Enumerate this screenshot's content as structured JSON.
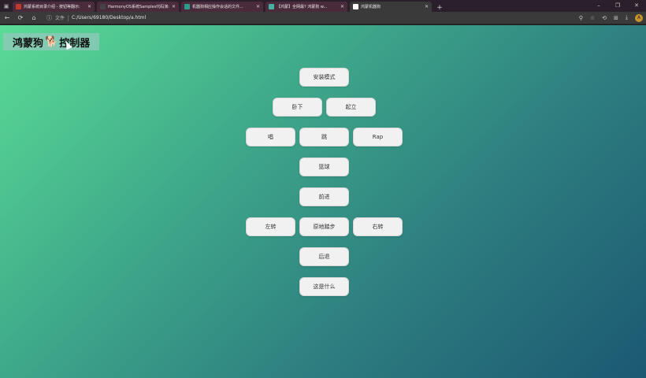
{
  "browser": {
    "tabs": [
      {
        "title": "鸿蒙系统目录介绍 - 按钮等翻示:",
        "color": "#c0392b"
      },
      {
        "title": "HarmonyOS系统Samples代码演:",
        "color": "#444444"
      },
      {
        "title": "机器狗相应操作会话的文件...",
        "color": "#2a9d8f"
      },
      {
        "title": "【鸿蒙】全网最? 鸿蒙狗 w...",
        "color": "#48b0a0"
      },
      {
        "title": "鸿蒙机器狗",
        "color": "#ffffff"
      }
    ],
    "address_scheme": "文件",
    "url": "C:/Users/69180/Desktop/a.html",
    "nav_icons": [
      "←",
      "⟳",
      "⌂"
    ],
    "right_icons": [
      "⚲",
      "☆",
      "⟲",
      "⊞",
      "⤓"
    ],
    "window_controls": [
      "–",
      "❐",
      "✕"
    ],
    "avatar_letter": "A"
  },
  "page": {
    "title": "鸿蒙狗",
    "title_suffix": "控制器",
    "dog_glyph": "🐕",
    "buttons": {
      "install": "安装模式",
      "lie": "卧下",
      "stand": "起立",
      "sing": "唱",
      "jump": "跳",
      "rap": "Rap",
      "basketball": "篮球",
      "forward": "前进",
      "left": "左转",
      "march": "原地踏步",
      "right": "右转",
      "back": "后退",
      "what": "这是什么"
    }
  }
}
